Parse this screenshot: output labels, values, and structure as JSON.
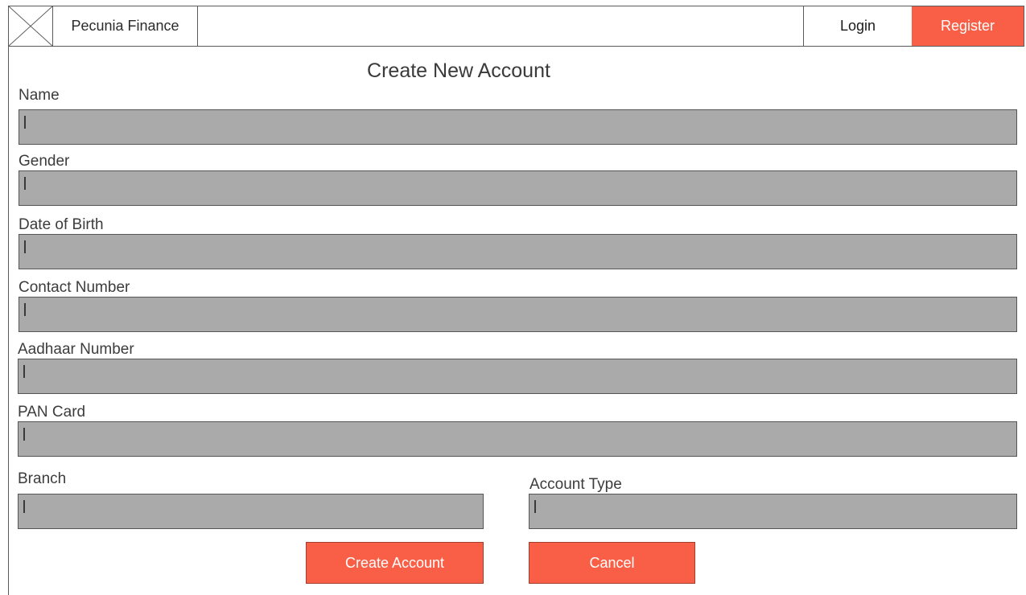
{
  "header": {
    "logo_icon": "image-placeholder-icon",
    "brand": "Pecunia Finance",
    "login_label": "Login",
    "register_label": "Register"
  },
  "form": {
    "title": "Create New Account",
    "fields": {
      "name": {
        "label": "Name",
        "value": ""
      },
      "gender": {
        "label": "Gender",
        "value": ""
      },
      "dob": {
        "label": "Date of Birth",
        "value": ""
      },
      "contact": {
        "label": "Contact Number",
        "value": ""
      },
      "aadhaar": {
        "label": "Aadhaar Number",
        "value": ""
      },
      "pan": {
        "label": "PAN Card",
        "value": ""
      },
      "branch": {
        "label": "Branch",
        "value": ""
      },
      "account_type": {
        "label": "Account Type",
        "value": ""
      }
    },
    "create_label": "Create Account",
    "cancel_label": "Cancel"
  },
  "colors": {
    "accent": "#f95f46",
    "input_bg": "#aaaaaa",
    "border": "#5a5a5a"
  }
}
